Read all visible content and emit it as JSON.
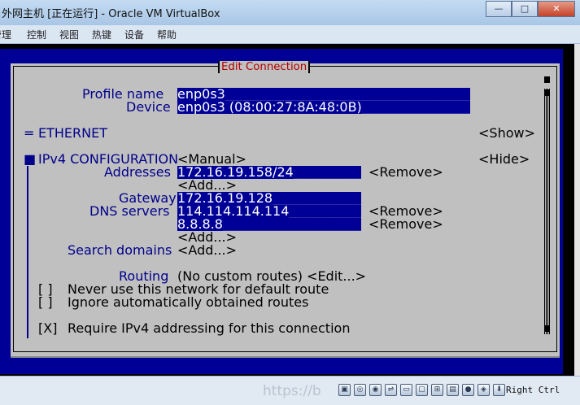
{
  "window": {
    "title": "外网主机 [正在运行] - Oracle VM VirtualBox",
    "minimize_glyph": "—",
    "maximize_glyph": "□",
    "close_glyph": "✕"
  },
  "menu": [
    "管理",
    "控制",
    "视图",
    "热键",
    "设备",
    "帮助"
  ],
  "tui": {
    "title": "Edit Connection",
    "profile_label": "Profile name",
    "profile_value": "enp0s3",
    "device_label": "Device",
    "device_value": "enp0s3 (08:00:27:8A:48:0B)",
    "ethernet_marker": "=",
    "ethernet_label": "ETHERNET",
    "show_button": "<Show>",
    "ipv4_marker": "■",
    "ipv4_label": "IPv4 CONFIGURATION",
    "ipv4_mode": "<Manual>",
    "hide_button": "<Hide>",
    "addresses_label": "Addresses",
    "address_value": "172.16.19.158/24",
    "remove_label": "<Remove>",
    "add_label": "<Add...>",
    "gateway_label": "Gateway",
    "gateway_value": "172.16.19.128",
    "dns_label": "DNS servers",
    "dns_values": [
      "114.114.114.114",
      "8.8.8.8"
    ],
    "search_label": "Search domains",
    "routing_label": "Routing",
    "routing_value": "(No custom routes) <Edit...>",
    "never_default_check": "[ ]",
    "never_default_label": "Never use this network for default route",
    "ignore_auto_check": "[ ]",
    "ignore_auto_label": "Ignore automatically obtained routes",
    "require_ipv4_check": "[X]",
    "require_ipv4_label": "Require IPv4 addressing for this connection"
  },
  "status": {
    "watermark": "https://b",
    "right_ctrl": "Right Ctrl"
  },
  "icons": [
    "title-app-icon",
    "harddisk-icon",
    "optical-icon",
    "audio-icon",
    "usb-icon",
    "shared-folder-icon",
    "display-icon",
    "network-icon",
    "capture-icon",
    "record-icon",
    "cpu-icon",
    "mouse-icon",
    "keyboard-arrow-icon"
  ],
  "colors": {
    "tui_blue": "#000096",
    "tui_gray": "#c0c0c0",
    "tui_title_red": "#b00000",
    "tui_label_navy": "#00008b"
  }
}
